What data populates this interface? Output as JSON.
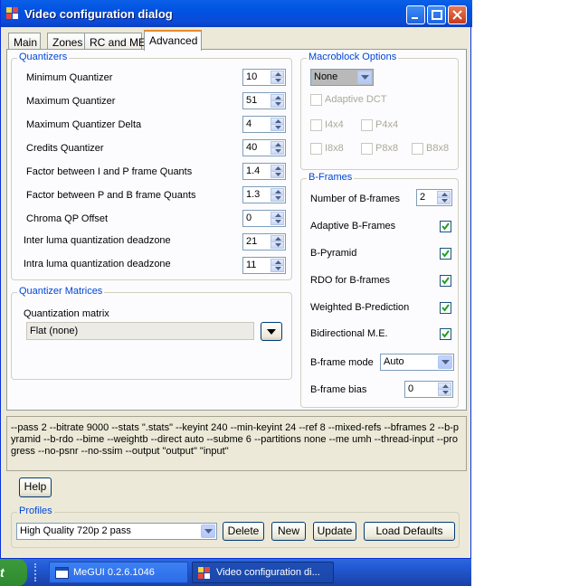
{
  "window": {
    "title": "Video configuration dialog"
  },
  "tabs": [
    {
      "label": "Main"
    },
    {
      "label": "Zones"
    },
    {
      "label": "RC and ME"
    },
    {
      "label": "Advanced",
      "active": true
    }
  ],
  "quantizers": {
    "title": "Quantizers",
    "rows": [
      {
        "label": "Minimum Quantizer",
        "value": "10"
      },
      {
        "label": "Maximum Quantizer",
        "value": "51"
      },
      {
        "label": "Maximum Quantizer Delta",
        "value": "4"
      },
      {
        "label": "Credits Quantizer",
        "value": "40"
      },
      {
        "label": "Factor between I and P frame Quants",
        "value": "1.4"
      },
      {
        "label": "Factor between P and B frame Quants",
        "value": "1.3"
      },
      {
        "label": "Chroma QP Offset",
        "value": "0"
      },
      {
        "label": "Inter luma quantization deadzone",
        "value": "21"
      },
      {
        "label": "Intra luma quantization deadzone",
        "value": "11"
      }
    ]
  },
  "matrices": {
    "title": "Quantizer Matrices",
    "label": "Quantization matrix",
    "value": "Flat (none)"
  },
  "macroblock": {
    "title": "Macroblock Options",
    "select_value": "None",
    "adaptive_dct": "Adaptive DCT",
    "options": [
      "I4x4",
      "P4x4",
      "I8x8",
      "P8x8",
      "B8x8"
    ]
  },
  "bframes": {
    "title": "B-Frames",
    "number_label": "Number of B-frames",
    "number_value": "2",
    "checks": [
      {
        "label": "Adaptive B-Frames",
        "checked": true
      },
      {
        "label": "B-Pyramid",
        "checked": true
      },
      {
        "label": "RDO for B-frames",
        "checked": true
      },
      {
        "label": "Weighted B-Prediction",
        "checked": true
      },
      {
        "label": "Bidirectional M.E.",
        "checked": true
      }
    ],
    "mode_label": "B-frame mode",
    "mode_value": "Auto",
    "bias_label": "B-frame bias",
    "bias_value": "0"
  },
  "commandline": "--pass 2 --bitrate 9000 --stats \".stats\" --keyint 240 --min-keyint 24 --ref 8 --mixed-refs --bframes 2 --b-pyramid --b-rdo --bime --weightb --direct auto --subme 6 --partitions none --me umh --thread-input --progress --no-psnr --no-ssim --output \"output\" \"input\"",
  "help_label": "Help",
  "profiles": {
    "title": "Profiles",
    "value": "High Quality 720p 2 pass",
    "delete_label": "Delete",
    "new_label": "New",
    "update_label": "Update",
    "load_defaults_label": "Load Defaults"
  },
  "taskbar": {
    "start_label": "t",
    "tasks": [
      {
        "label": "MeGUI 0.2.6.1046"
      },
      {
        "label": "Video configuration di..."
      }
    ]
  },
  "colors": {
    "group_title": "#0046d5",
    "title_bar": "#0053e0",
    "check": "#21a121"
  }
}
